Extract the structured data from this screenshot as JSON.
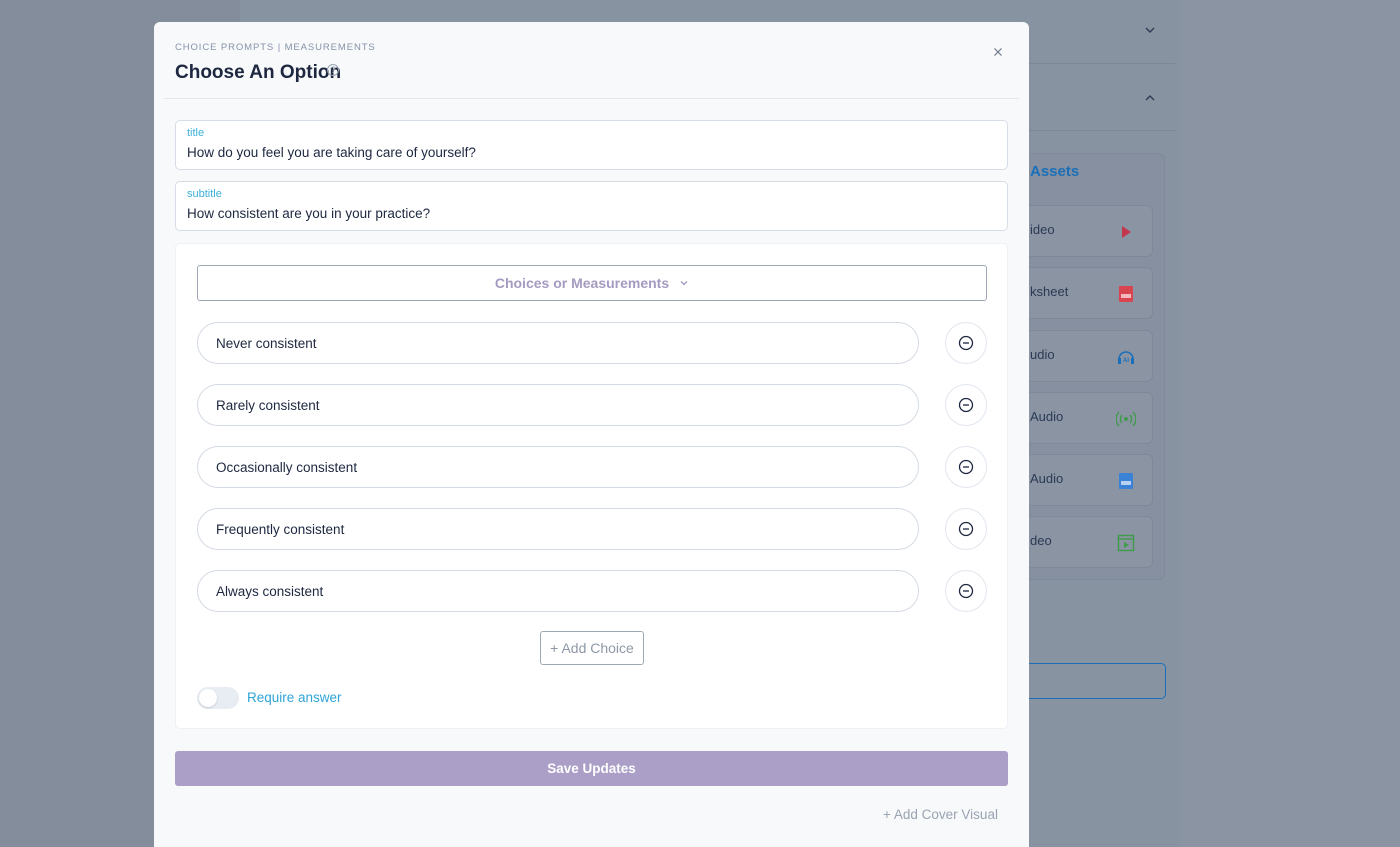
{
  "background": {
    "assets_heading": "Assets",
    "items": [
      {
        "label": "ideo",
        "icon": "play-icon",
        "color": "#c2384f"
      },
      {
        "label": "ksheet",
        "icon": "pdf-file-icon",
        "color": "#d9454f"
      },
      {
        "label": "udio",
        "icon": "ai-headphones-icon",
        "color": "#1b6fb8"
      },
      {
        "label": "Audio",
        "icon": "broadcast-icon",
        "color": "#3f9b4a"
      },
      {
        "label": "Audio",
        "icon": "audio-file-icon",
        "color": "#3b82d6"
      },
      {
        "label": "deo",
        "icon": "video-file-icon",
        "color": "#3f9b4a"
      }
    ]
  },
  "modal": {
    "breadcrumb": "CHOICE PROMPTS | MEASUREMENTS",
    "title": "Choose An Option",
    "help_icon": "?",
    "title_field": {
      "label": "title",
      "value": "How do you feel you are taking care of yourself?"
    },
    "subtitle_field": {
      "label": "subtitle",
      "value": "How consistent are you in your practice?"
    },
    "dropdown": {
      "label": "Choices or Measurements"
    },
    "choices": [
      "Never consistent",
      "Rarely consistent",
      "Occasionally consistent",
      "Frequently consistent",
      "Always consistent"
    ],
    "add_choice_label": "+ Add Choice",
    "require_answer_label": "Require answer",
    "require_answer_on": false,
    "save_label": "Save Updates",
    "add_cover_label": "+ Add Cover Visual"
  },
  "colors": {
    "accent_blue": "#2fa4d6",
    "save_purple": "#ab9fc7",
    "overlay": "#8a94a3"
  }
}
